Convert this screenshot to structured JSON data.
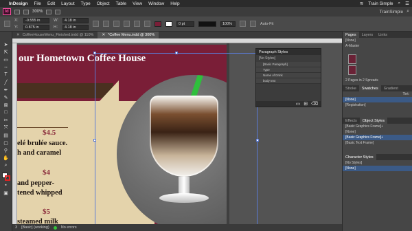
{
  "menubar": {
    "app_name": "InDesign",
    "items": [
      "File",
      "Edit",
      "Layout",
      "Type",
      "Object",
      "Table",
      "View",
      "Window",
      "Help"
    ],
    "right_label": "Train Simple"
  },
  "appbar": {
    "badge": "Id",
    "zoom": "300%",
    "workspace": "TrainSimple"
  },
  "control": {
    "x": "-0.555 in",
    "y": "0.875 in",
    "w": "4.18 in",
    "h": "4.18 in",
    "stroke_weight": "0 pt",
    "percent": "100%",
    "autofit": "Auto-Fit"
  },
  "tabs": [
    {
      "label": "CoffeeHouseMenu_Finished.indd @ 110%",
      "active": false
    },
    {
      "label": "*Coffee Menu.indd @ 300%",
      "active": true
    }
  ],
  "document": {
    "headline": "our Hometown Coffee House",
    "lines": [
      "elé brulée sauce.",
      "h and caramel",
      "and pepper-",
      "tened whipped",
      "steamed milk"
    ],
    "prices": [
      "$4.5",
      "$4",
      "$5"
    ]
  },
  "paragraph_styles": {
    "title": "Paragraph Styles",
    "current": "[No Styles]",
    "items": [
      "[Basic Paragraph]",
      "Type",
      "Name of Drink",
      "body text"
    ]
  },
  "dock": {
    "pages_tabs": [
      "Pages",
      "Layers",
      "Links"
    ],
    "masters": [
      "[None]",
      "A-Master"
    ],
    "pages_info": "2 Pages in 2 Spreads",
    "swatch_tabs": [
      "Stroke",
      "Swatches",
      "Gradient"
    ],
    "tint_label": "Tint:",
    "swatches": [
      "[None]",
      "[Registration]"
    ],
    "effects_tabs": [
      "Effects",
      "Object Styles"
    ],
    "object_current": "[Basic Graphics Frame]+",
    "object_styles": [
      "[None]",
      "[Basic Graphics Frame]+",
      "[Basic Text Frame]"
    ],
    "char_title": "Character Styles",
    "char_current": "[No Styles]",
    "char_items": [
      "[None]"
    ]
  },
  "status": {
    "page": "3",
    "mode": "[Basic] (working)",
    "errors": "No errors"
  },
  "colors": {
    "page_bg": "#7a1e37",
    "accent_green": "#2fbf3c",
    "selection": "#5b7bd6"
  }
}
